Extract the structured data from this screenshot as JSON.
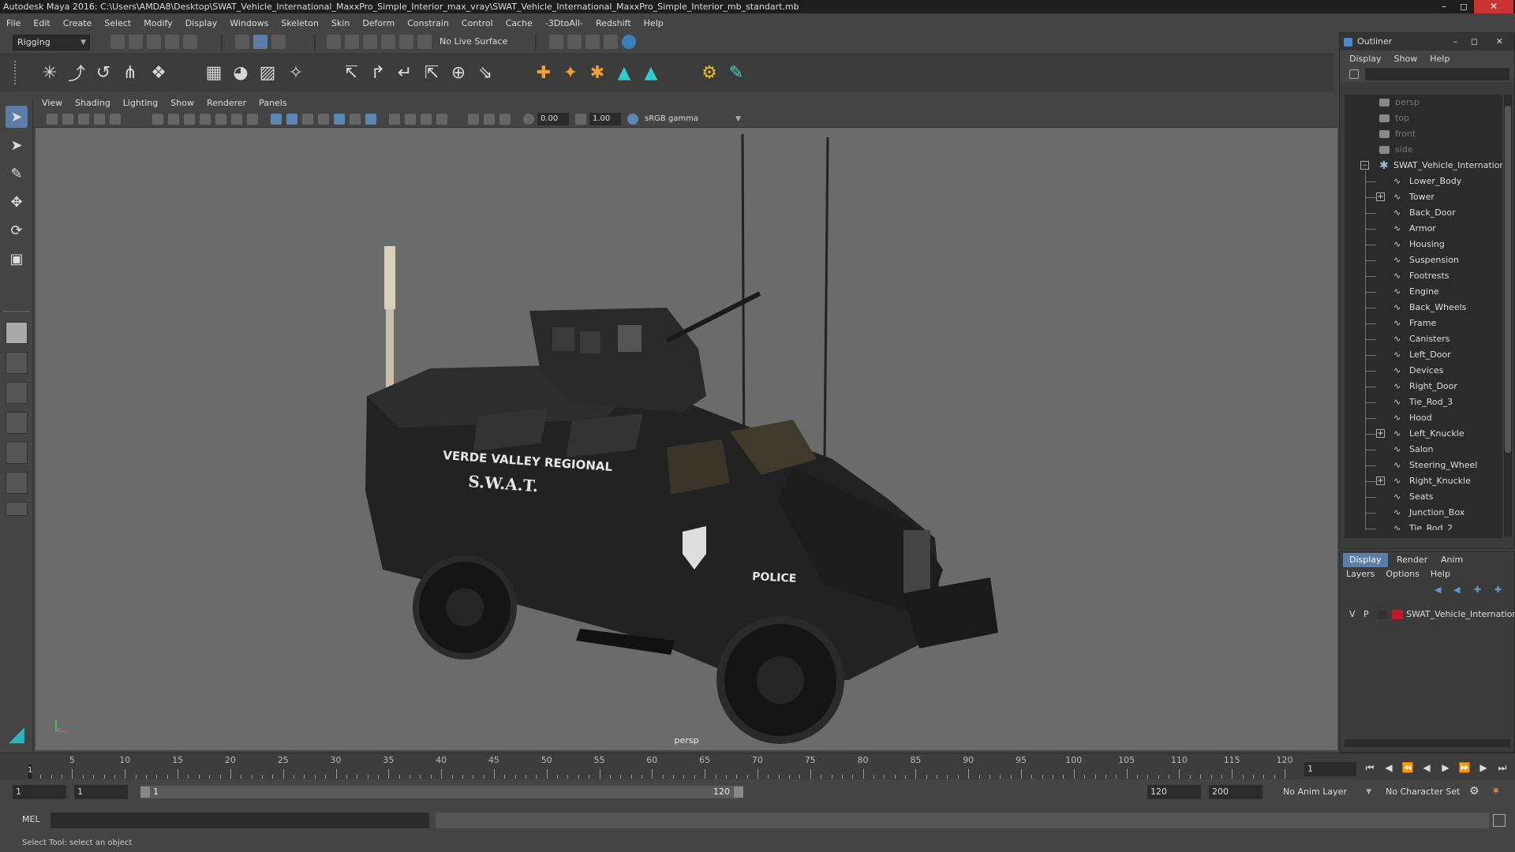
{
  "window": {
    "title": "Autodesk Maya 2016: C:\\Users\\AMDA8\\Desktop\\SWAT_Vehicle_International_MaxxPro_Simple_Interior_max_vray\\SWAT_Vehicle_International_MaxxPro_Simple_Interior_mb_standart.mb"
  },
  "menubar": [
    "File",
    "Edit",
    "Create",
    "Select",
    "Modify",
    "Display",
    "Windows",
    "Skeleton",
    "Skin",
    "Deform",
    "Constrain",
    "Control",
    "Cache",
    "-3DtoAll-",
    "Redshift",
    "Help"
  ],
  "statusline": {
    "menuset": "Rigging",
    "live_surface": "No Live Surface"
  },
  "panel_menu": [
    "View",
    "Shading",
    "Lighting",
    "Show",
    "Renderer",
    "Panels"
  ],
  "panel_toolbar": {
    "exposure": "0.00",
    "gamma": "1.00",
    "color_space": "sRGB gamma"
  },
  "viewport": {
    "camera": "persp",
    "vehicle_text": {
      "line1": "VERDE VALLEY REGIONAL",
      "line2": "S.W.A.T.",
      "door": "POLICE"
    }
  },
  "outliner": {
    "title": "Outliner",
    "menu": [
      "Display",
      "Show",
      "Help"
    ],
    "cameras": [
      "persp",
      "top",
      "front",
      "side"
    ],
    "root": "SWAT_Vehicle_Internation",
    "children": [
      {
        "label": "Lower_Body",
        "expand": false
      },
      {
        "label": "Tower",
        "expand": true
      },
      {
        "label": "Back_Door",
        "expand": false
      },
      {
        "label": "Armor",
        "expand": false
      },
      {
        "label": "Housing",
        "expand": false
      },
      {
        "label": "Suspension",
        "expand": false
      },
      {
        "label": "Footrests",
        "expand": false
      },
      {
        "label": "Engine",
        "expand": false
      },
      {
        "label": "Back_Wheels",
        "expand": false
      },
      {
        "label": "Frame",
        "expand": false
      },
      {
        "label": "Canisters",
        "expand": false
      },
      {
        "label": "Left_Door",
        "expand": false
      },
      {
        "label": "Devices",
        "expand": false
      },
      {
        "label": "Right_Door",
        "expand": false
      },
      {
        "label": "Tie_Rod_3",
        "expand": false
      },
      {
        "label": "Hood",
        "expand": false
      },
      {
        "label": "Left_Knuckle",
        "expand": true
      },
      {
        "label": "Salon",
        "expand": false
      },
      {
        "label": "Steering_Wheel",
        "expand": false
      },
      {
        "label": "Right_Knuckle",
        "expand": true
      },
      {
        "label": "Seats",
        "expand": false
      },
      {
        "label": "Junction_Box",
        "expand": false
      },
      {
        "label": "Tie_Rod_2",
        "expand": false
      }
    ]
  },
  "layers": {
    "tabs": [
      "Display",
      "Render",
      "Anim"
    ],
    "active_tab": "Display",
    "menu": [
      "Layers",
      "Options",
      "Help"
    ],
    "row": {
      "v": "V",
      "p": "P",
      "name": "SWAT_Vehicle_Internatior",
      "color": "#c11a2b"
    }
  },
  "timeline": {
    "ticks": [
      5,
      10,
      15,
      20,
      25,
      30,
      35,
      40,
      45,
      50,
      55,
      60,
      65,
      70,
      75,
      80,
      85,
      90,
      95,
      100,
      105,
      110,
      115,
      120
    ],
    "start": 1,
    "end": 120,
    "current_marker": "1",
    "current_frame": "1"
  },
  "range": {
    "start": "1",
    "playback_start": "1",
    "range_start_label": "1",
    "range_end_label": "120",
    "playback_end": "120",
    "end": "200",
    "anim_layer": "No Anim Layer",
    "character_set": "No Character Set"
  },
  "command": {
    "language": "MEL"
  },
  "helpline": "Select Tool: select an object"
}
